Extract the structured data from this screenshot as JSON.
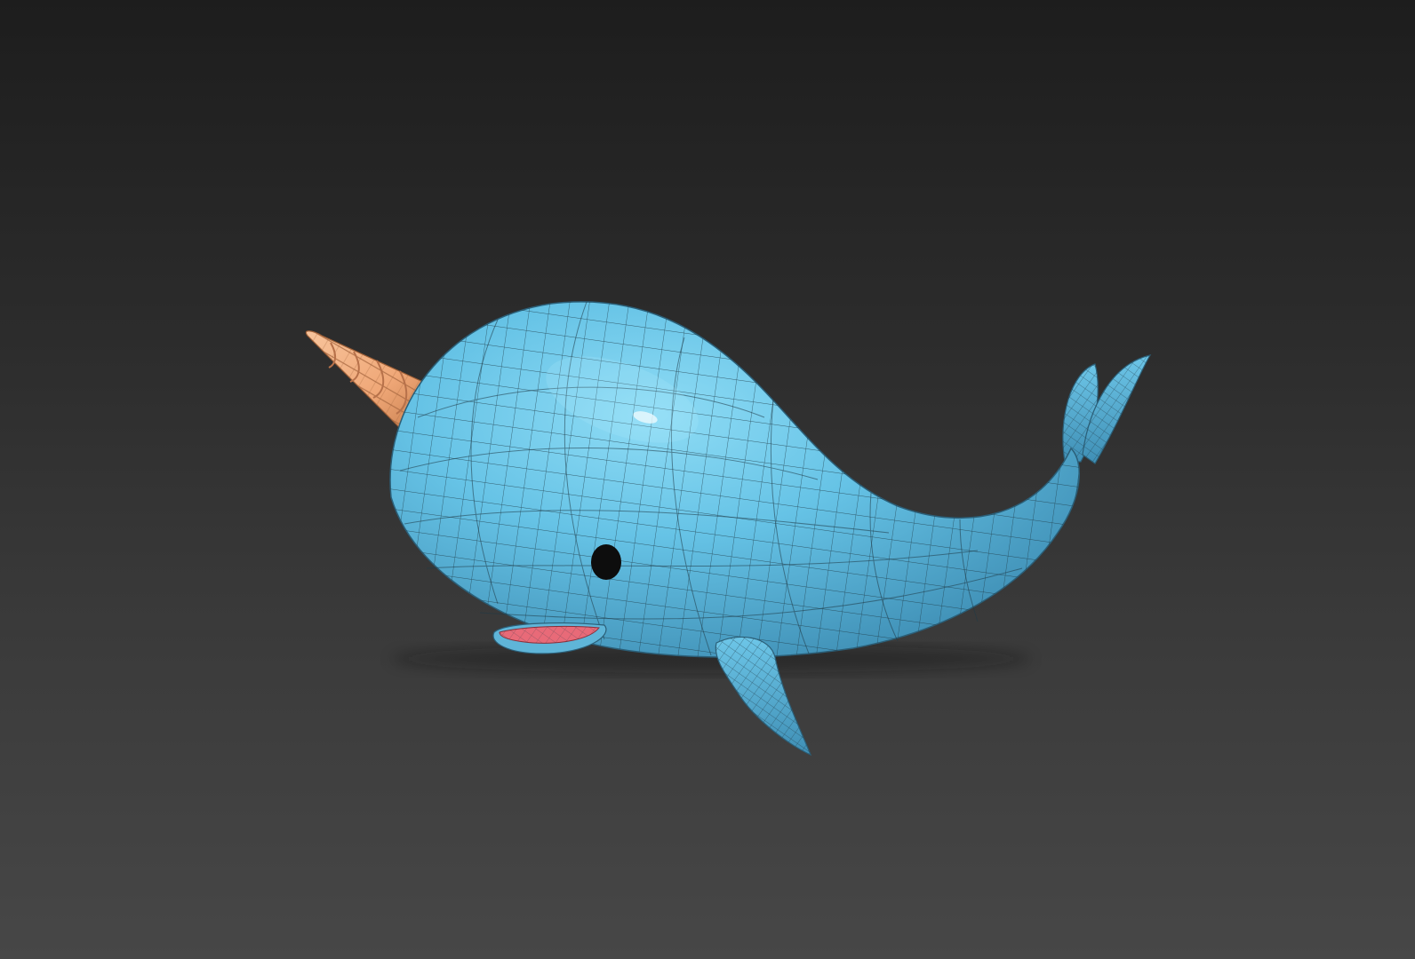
{
  "viewport": {
    "background_top": "#1d1d1d",
    "background_bottom": "#474747"
  },
  "model": {
    "subject": "narwhal",
    "body_color": "#66c3e6",
    "body_highlight": "#8fdcf5",
    "body_shadow": "#3f8fb5",
    "horn_color": "#f0a878",
    "mouth_color": "#e86a78",
    "eye_color": "#0d0d0d",
    "wireframe_color": "#1f3a47",
    "wireframe": true
  }
}
